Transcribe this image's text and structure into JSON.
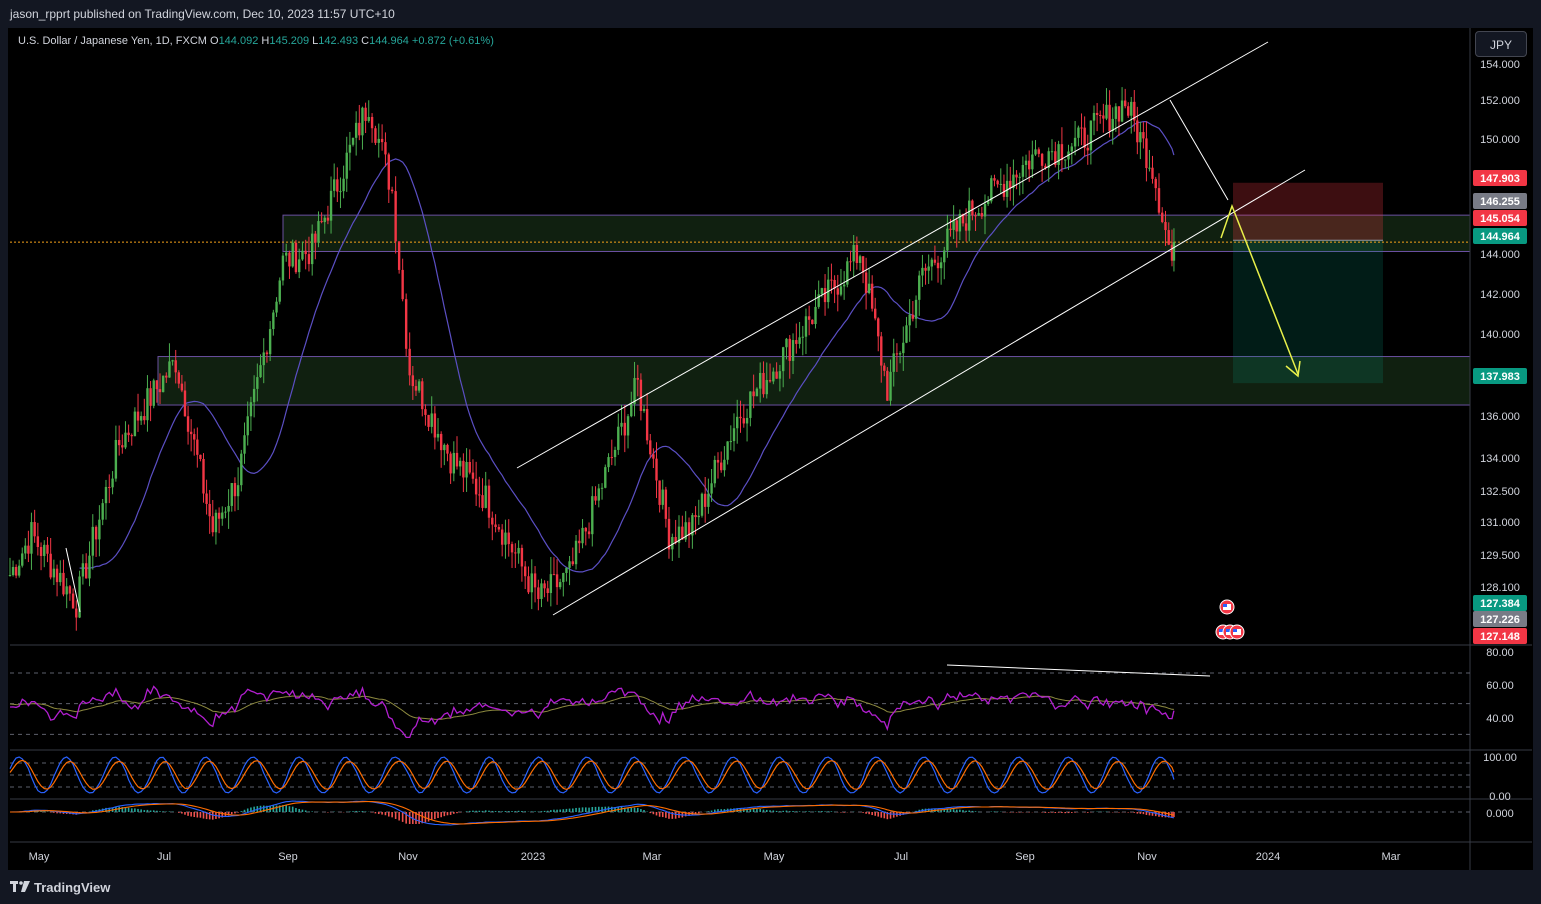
{
  "header": {
    "publish_line": "jason_rpprt published on TradingView.com, Dec 10, 2023 11:57 UTC+10"
  },
  "footer": {
    "brand": "TradingView"
  },
  "currency_button": "JPY",
  "symbol": {
    "name": "U.S. Dollar / Japanese Yen, 1D, FXCM",
    "o_label": "O",
    "o": "144.092",
    "h_label": "H",
    "h": "145.209",
    "l_label": "L",
    "l": "142.493",
    "c_label": "C",
    "c": "144.964",
    "change": "+0.872 (+0.61%)"
  },
  "colors": {
    "up": "#26a69a",
    "down": "#ef5350",
    "candle_up": "#4caf50",
    "candle_down": "#f23645",
    "ma": "#5b4fc4",
    "rsi": "#b21fd0",
    "zone": "#1d3b1d",
    "arrow": "#e8f04a"
  },
  "price_labels": [
    {
      "text": "147.903",
      "bg": "#f23645"
    },
    {
      "text": "146.255",
      "bg": "#787b86"
    },
    {
      "text": "145.054",
      "bg": "#f23645"
    },
    {
      "text": "144.964",
      "bg": "#089981"
    },
    {
      "text": "137.983",
      "bg": "#089981"
    },
    {
      "text": "127.384",
      "bg": "#089981"
    },
    {
      "text": "127.226",
      "bg": "#787b86"
    },
    {
      "text": "127.148",
      "bg": "#f23645"
    }
  ],
  "chart_data": [
    {
      "type": "candlestick",
      "title": "U.S. Dollar / Japanese Yen, 1D, FXCM",
      "x_ticks": [
        "May",
        "Jul",
        "Sep",
        "Nov",
        "2023",
        "Mar",
        "May",
        "Jul",
        "Sep",
        "Nov",
        "2024",
        "Mar"
      ],
      "y_ticks": [
        "154.000",
        "152.000",
        "150.000",
        "148.000",
        "146.000",
        "144.000",
        "142.000",
        "140.000",
        "138.000",
        "136.000",
        "134.000",
        "132.500",
        "131.000",
        "129.500",
        "128.100"
      ],
      "series": [
        {
          "name": "close",
          "x": [
            "2022-04-20",
            "2022-05-01",
            "2022-05-24",
            "2022-06-15",
            "2022-07-14",
            "2022-08-02",
            "2022-08-15",
            "2022-09-07",
            "2022-09-22",
            "2022-10-21",
            "2022-11-02",
            "2022-11-11",
            "2022-12-02",
            "2022-12-20",
            "2023-01-16",
            "2023-02-01",
            "2023-03-08",
            "2023-03-24",
            "2023-04-05",
            "2023-04-28",
            "2023-05-30",
            "2023-06-30",
            "2023-07-14",
            "2023-08-01",
            "2023-08-25",
            "2023-09-28",
            "2023-10-20",
            "2023-11-13",
            "2023-11-27",
            "2023-12-07",
            "2023-12-08"
          ],
          "values": [
            128.5,
            130.5,
            127.1,
            135.0,
            139.1,
            130.7,
            133.3,
            144.0,
            144.6,
            151.9,
            147.5,
            138.6,
            134.3,
            132.3,
            127.3,
            128.5,
            137.9,
            130.5,
            130.8,
            136.3,
            140.5,
            144.5,
            137.7,
            143.3,
            146.4,
            149.3,
            149.9,
            151.9,
            148.7,
            144.0,
            144.96
          ]
        },
        {
          "name": "MA",
          "values": []
        }
      ],
      "annotations": {
        "zones": [
          {
            "from": 144.5,
            "to": 146.3
          },
          {
            "from": 136.9,
            "to": 139.3
          }
        ],
        "short_position": {
          "entry": 145.054,
          "stop": 147.903,
          "target": 137.983
        },
        "current_price": 144.964
      }
    },
    {
      "type": "line",
      "title": "",
      "y_ticks": [
        "80.00",
        "60.00",
        "40.00"
      ],
      "levels": [
        70,
        50,
        30
      ],
      "series": [
        {
          "name": "",
          "values": []
        }
      ]
    },
    {
      "type": "line",
      "title": "",
      "y_ticks": [
        "100.00",
        "0.00"
      ],
      "series": [
        {
          "name": "",
          "values": []
        }
      ]
    },
    {
      "type": "bar",
      "title": "",
      "y_ticks": [
        "0.000"
      ],
      "series": [
        {
          "name": "",
          "values": []
        }
      ]
    }
  ]
}
